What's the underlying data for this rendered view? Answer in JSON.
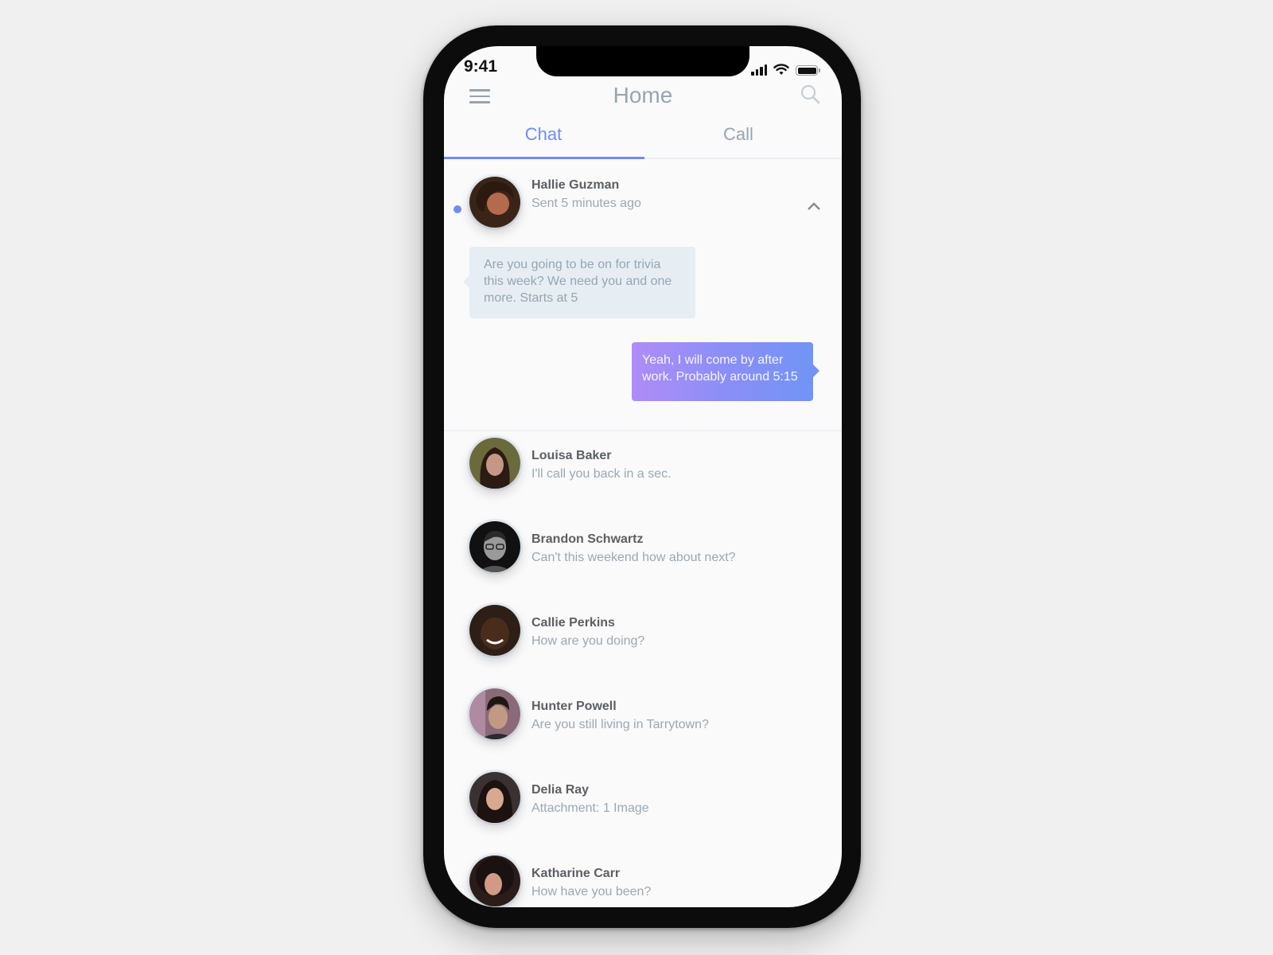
{
  "status_bar": {
    "time": "9:41"
  },
  "header": {
    "title": "Home"
  },
  "tabs": [
    {
      "label": "Chat",
      "active": true
    },
    {
      "label": "Call",
      "active": false
    }
  ],
  "colors": {
    "accent": "#6f8cf5",
    "muted_text": "#96a5b0",
    "incoming_bubble": "#e6eef4",
    "outgoing_gradient_start": "#b08cf7",
    "outgoing_gradient_end": "#7194f5"
  },
  "expanded_chat": {
    "name": "Hallie Guzman",
    "status": "Sent 5 minutes ago",
    "unread": true,
    "messages": [
      {
        "direction": "incoming",
        "text": "Are you going to be on for trivia this week? We need you and one more. Starts at 5"
      },
      {
        "direction": "outgoing",
        "text": "Yeah, I will come by after work. Probably around 5:15"
      }
    ]
  },
  "chats": [
    {
      "name": "Louisa Baker",
      "preview": "I'll call you back in a sec."
    },
    {
      "name": "Brandon Schwartz",
      "preview": "Can't this weekend how about next?"
    },
    {
      "name": "Callie Perkins",
      "preview": "How are you doing?"
    },
    {
      "name": "Hunter Powell",
      "preview": "Are you still living in Tarrytown?"
    },
    {
      "name": "Delia Ray",
      "preview": "Attachment: 1 Image"
    },
    {
      "name": "Katharine Carr",
      "preview": "How have you been?"
    }
  ]
}
